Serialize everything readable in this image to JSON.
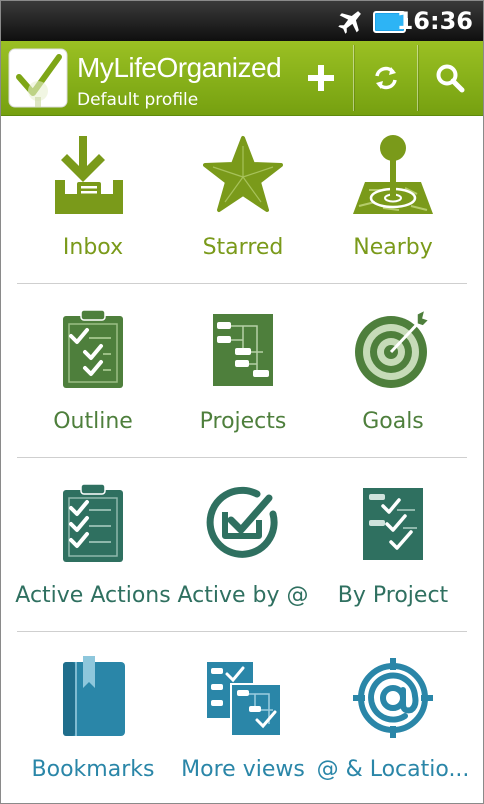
{
  "status_bar": {
    "time": "16:36",
    "icons": [
      "airplane-icon",
      "battery-icon"
    ]
  },
  "action_bar": {
    "title": "MyLifeOrganized",
    "subtitle": "Default profile",
    "buttons": [
      "add-icon",
      "sync-icon",
      "search-icon"
    ]
  },
  "colors": {
    "brand_green": "#88b11a",
    "row1_text": "#7a9a1a",
    "row2_text": "#4e7f3c",
    "row3_text": "#2f7060",
    "row4_text": "#2a86a8"
  },
  "grid": {
    "items": [
      {
        "label": "Inbox",
        "icon": "inbox-icon"
      },
      {
        "label": "Starred",
        "icon": "star-icon"
      },
      {
        "label": "Nearby",
        "icon": "nearby-pin-icon"
      },
      {
        "label": "Outline",
        "icon": "outline-clipboard-icon"
      },
      {
        "label": "Projects",
        "icon": "projects-diagram-icon"
      },
      {
        "label": "Goals",
        "icon": "target-icon"
      },
      {
        "label": "Active Actions",
        "icon": "active-actions-clipboard-icon"
      },
      {
        "label": "Active by @",
        "icon": "active-by-context-icon"
      },
      {
        "label": "By Project",
        "icon": "by-project-icon"
      },
      {
        "label": "Bookmarks",
        "icon": "bookmark-book-icon"
      },
      {
        "label": "More views",
        "icon": "more-views-icon"
      },
      {
        "label": "@ & Locatio...",
        "icon": "at-location-icon"
      }
    ]
  }
}
